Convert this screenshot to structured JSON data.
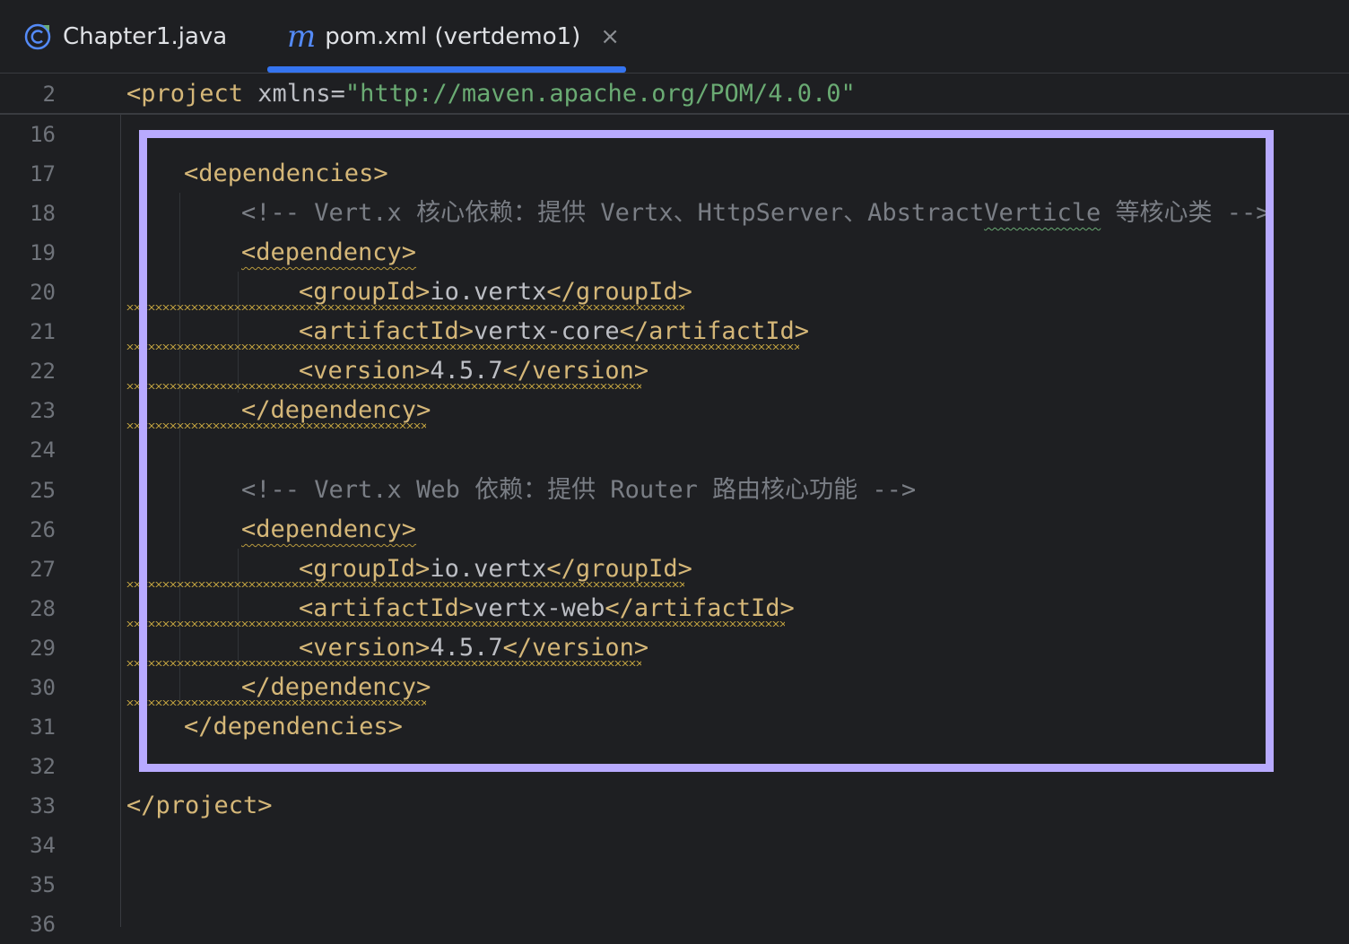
{
  "tabs": [
    {
      "label": "Chapter1.java",
      "icon": "java-class-icon",
      "active": false
    },
    {
      "label": "pom.xml (vertdemo1)",
      "icon": "maven-m-icon",
      "active": true,
      "close_glyph": "×"
    }
  ],
  "sticky": {
    "line_number": "2",
    "open": "<project",
    "attr": " xmlns=",
    "value": "\"http://maven.apache.org/POM/4.0.0\""
  },
  "line_numbers": [
    "16",
    "17",
    "18",
    "19",
    "20",
    "21",
    "22",
    "23",
    "24",
    "25",
    "26",
    "27",
    "28",
    "29",
    "30",
    "31",
    "32",
    "33",
    "34",
    "35",
    "36"
  ],
  "code": {
    "l17": "<dependencies>",
    "l18_comment_a": "<!-- Vert.x 核心依赖：提供 Vertx、HttpServer、Abstract",
    "l18_comment_b": "Verticle",
    "l18_comment_c": " 等核心类 -->",
    "l19": "<dependency>",
    "l20_open": "<groupId>",
    "l20_text": "io.vertx",
    "l20_close": "</groupId>",
    "l21_open": "<artifactId>",
    "l21_text": "vertx-core",
    "l21_close": "</artifactId>",
    "l22_open": "<version>",
    "l22_text": "4.5.7",
    "l22_close": "</version>",
    "l23": "</dependency>",
    "l25_comment": "<!-- Vert.x Web 依赖：提供 Router 路由核心功能 -->",
    "l26": "<dependency>",
    "l27_open": "<groupId>",
    "l27_text": "io.vertx",
    "l27_close": "</groupId>",
    "l28_open": "<artifactId>",
    "l28_text": "vertx-web",
    "l28_close": "</artifactId>",
    "l29_open": "<version>",
    "l29_text": "4.5.7",
    "l29_close": "</version>",
    "l30": "</dependency>",
    "l31": "</dependencies>",
    "l33": "</project>"
  },
  "colors": {
    "background": "#1e1f22",
    "tag": "#d5b778",
    "string": "#6aab73",
    "comment": "#7a7e85",
    "tab_accent": "#3574f0",
    "highlight_box": "#b8aaff",
    "warning_squiggle": "#b89a3e"
  }
}
